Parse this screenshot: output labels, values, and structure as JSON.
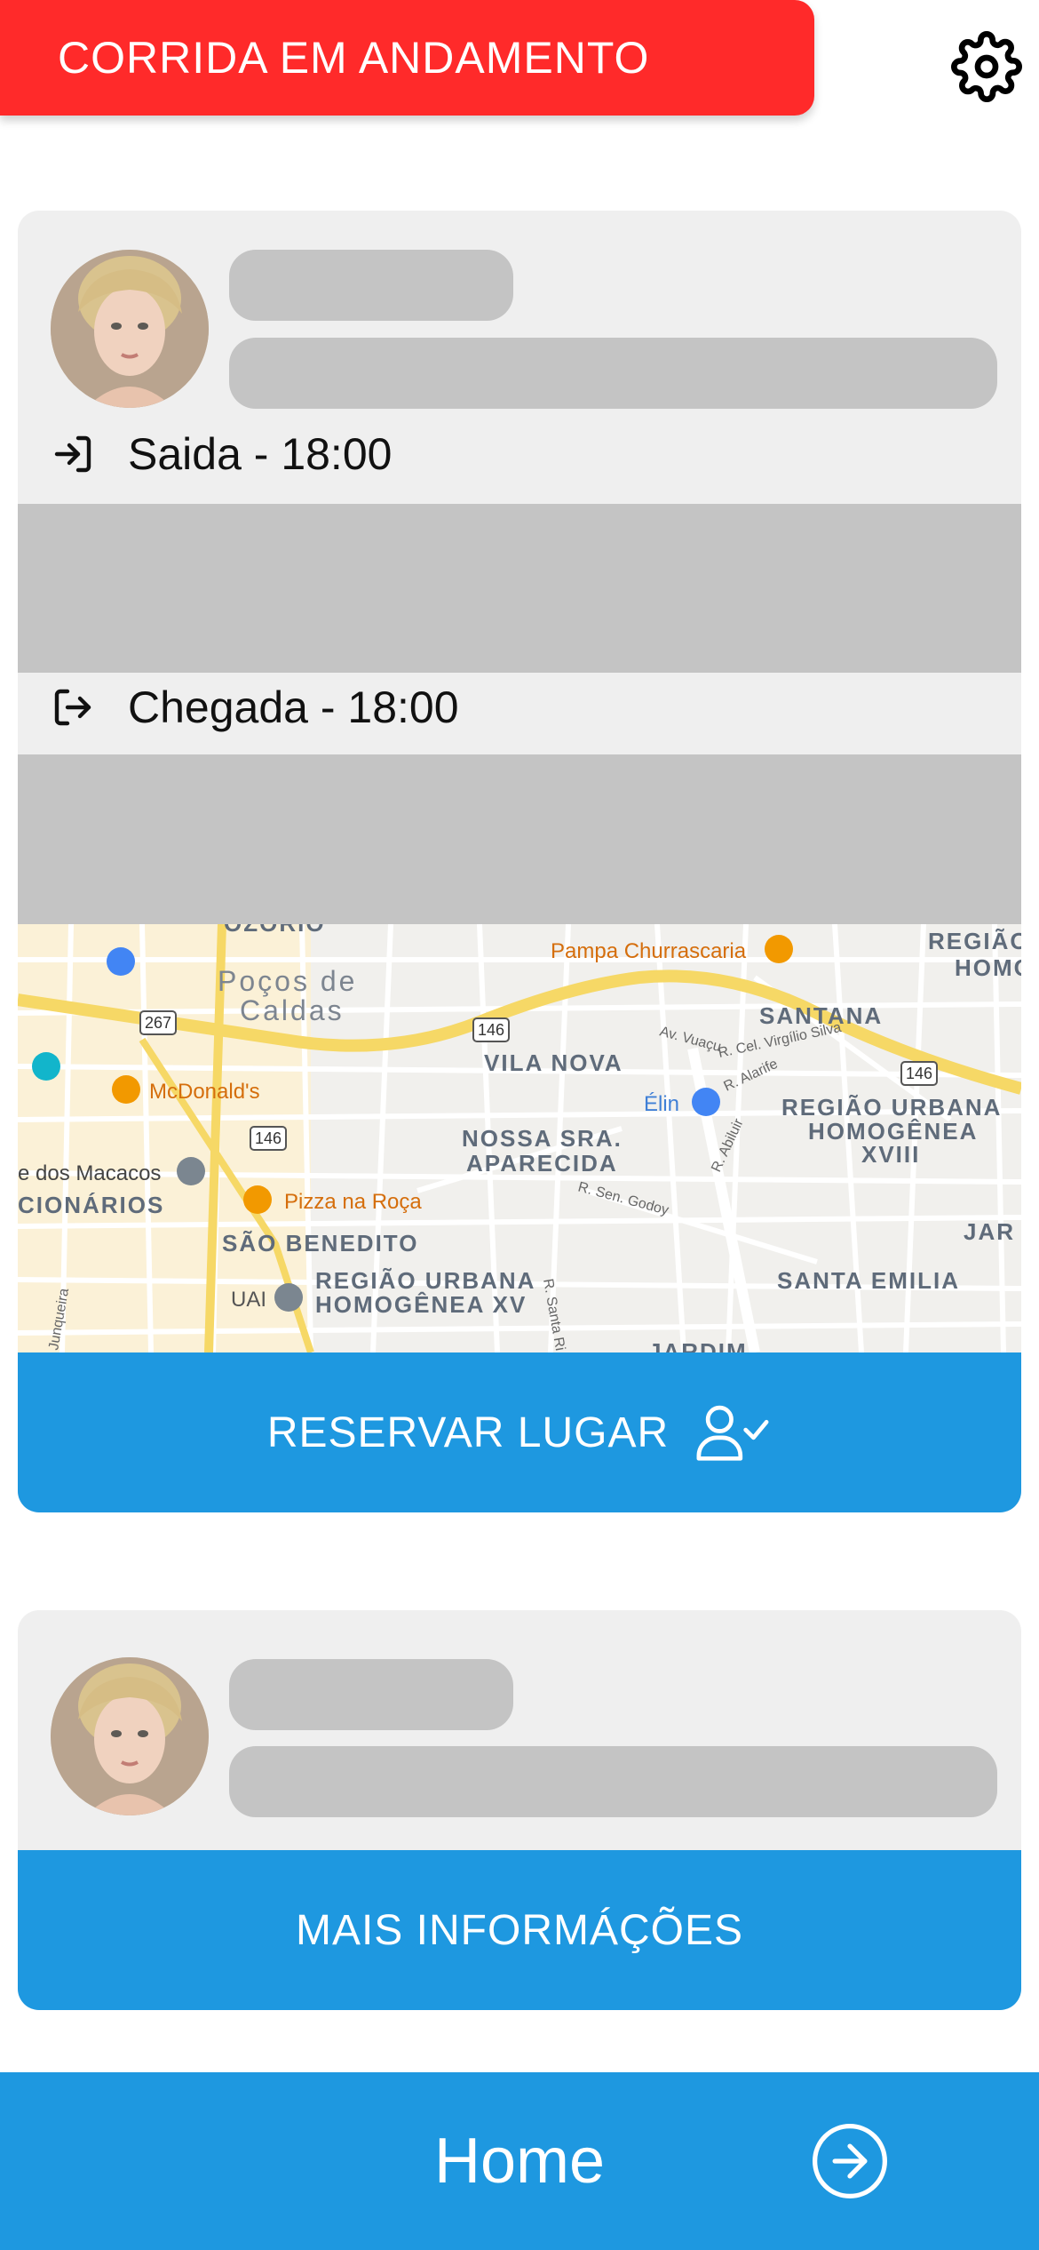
{
  "header": {
    "status_label": "CORRIDA EM ANDAMENTO",
    "status_color": "#ff2a2a",
    "settings_icon": "gear-icon"
  },
  "ride_card": {
    "departure_label": "Saida - 18:00",
    "arrival_label": "Chegada - 18:00",
    "departure_icon": "login-icon",
    "arrival_icon": "logout-icon",
    "map": {
      "labels": {
        "ozorio": "OZÓRIO",
        "pocos": "Poços de",
        "caldas": "Caldas",
        "pampa": "Pampa Churrascaria",
        "regiao_top1": "REGIÃO",
        "regiao_top2": "HOMO",
        "santana": "SANTANA",
        "vila_nova": "VILA NOVA",
        "mcdonalds": "McDonald's",
        "elin": "Élin",
        "regiao_xviii_1": "REGIÃO URBANA",
        "regiao_xviii_2": "HOMOGÊNEA",
        "regiao_xviii_3": "XVIII",
        "macacos": "e dos Macacos",
        "nossa_sra_1": "NOSSA SRA.",
        "nossa_sra_2": "APARECIDA",
        "pizza": "Pizza na Roça",
        "cionarios": "CIONÁRIOS",
        "sao_benedito": "SÃO BENEDITO",
        "regiao_xv_1": "REGIÃO URBANA",
        "regiao_xv_2": "HOMOGÊNEA XV",
        "uai": "UAI",
        "santa_emilia": "SANTA EMILIA",
        "jar": "JAR",
        "jardim": "JARDIM",
        "av_vuacu": "Av. Vuaçu",
        "r_cel_virgilio": "R. Cel. Virgílio Silva",
        "r_alarife": "R. Alarife",
        "r_sen_godoy": "R. Sen. Godoy",
        "r_abiluir": "R. Abiluir",
        "junqueira": "Junqueira",
        "r_santa_rita": "R. Santa Ri",
        "shield_267": "267",
        "shield_146a": "146",
        "shield_146b": "146",
        "shield_146c": "146"
      }
    },
    "reserve_button_label": "RESERVAR LUGAR",
    "reserve_icon": "user-check-icon"
  },
  "driver_card": {
    "more_info_button_label": "MAIS INFORMÁÇÕES"
  },
  "footer": {
    "home_label": "Home",
    "home_icon": "arrow-right-circle-icon",
    "accent_color": "#1e98e0"
  }
}
